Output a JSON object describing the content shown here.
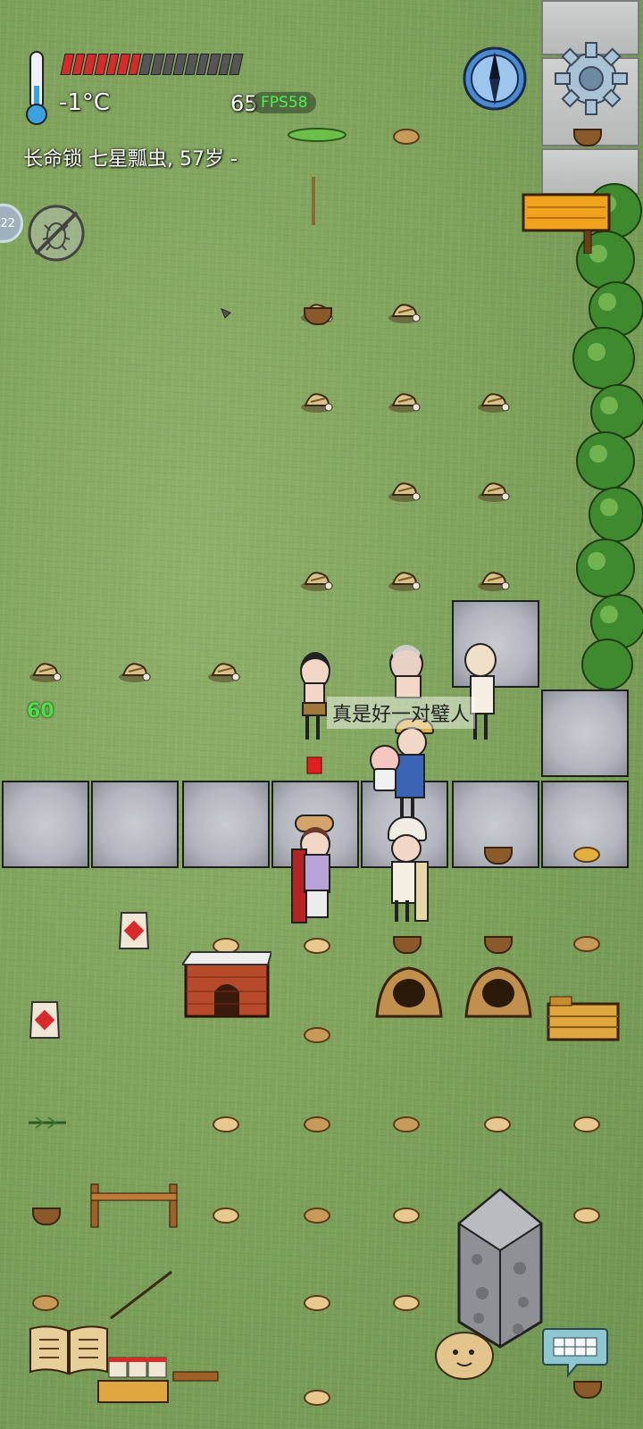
{
  "hud": {
    "temperature": "-1°C",
    "population": "65",
    "fps": "FPS58",
    "player_label": "长命锁 七星瓢虫, 57岁 -",
    "food_level": 0.44,
    "food_bars_total": 16,
    "side_chip": "22",
    "hover_number": "60"
  },
  "dialog": {
    "speech": "真是好一对璧人"
  },
  "colors": {
    "food_on": "#d72a2a",
    "food_off": "#555555",
    "fps_text": "#4df04d",
    "grass": "#7fa35c"
  },
  "icons": {
    "thermometer": "thermometer-icon",
    "compass": "compass-icon",
    "settings": "gear-icon",
    "insect": "no-insect-icon",
    "book": "recipe-book-icon",
    "keyboard": "keyboard-icon",
    "emote": "potato-emote-icon"
  }
}
